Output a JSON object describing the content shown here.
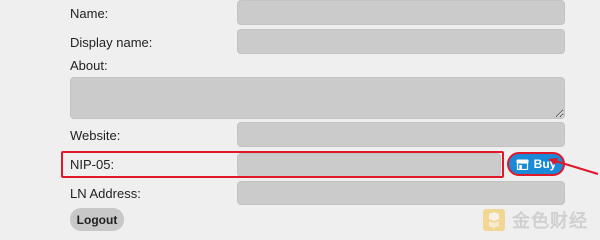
{
  "profile_form": {
    "fields": [
      {
        "label": "Name:",
        "value": ""
      },
      {
        "label": "Display name:",
        "value": ""
      },
      {
        "label": "About:",
        "value": ""
      },
      {
        "label": "Website:",
        "value": ""
      },
      {
        "label": "NIP-05:",
        "value": ""
      },
      {
        "label": "LN Address:",
        "value": ""
      }
    ],
    "buy_label": "Buy",
    "logout_label": "Logout"
  },
  "watermark": {
    "text": "金色财经"
  },
  "colors": {
    "background": "#efefef",
    "input_fill": "#cbcbcb",
    "highlight": "#e0182a",
    "buy_button": "#1a8ad6"
  },
  "icons": {
    "buy": "store-icon",
    "annotation": "red-arrow-icon",
    "watermark_logo": "jinse-logo-icon"
  }
}
